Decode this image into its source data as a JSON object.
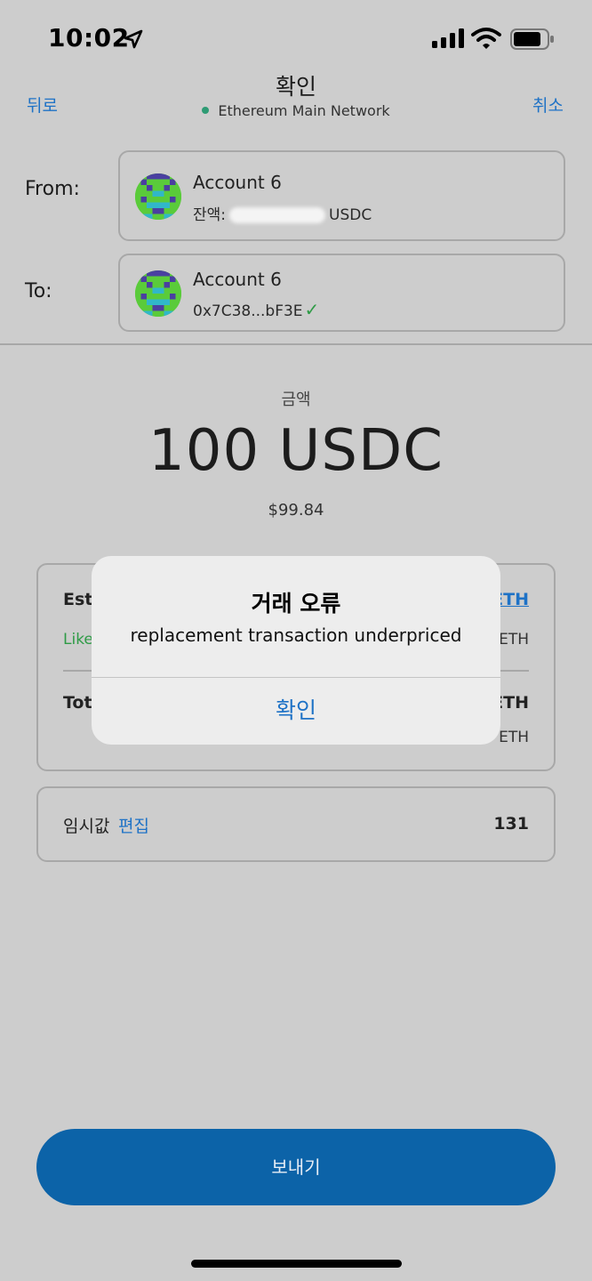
{
  "status_bar": {
    "time": "10:02",
    "icons": [
      "location-arrow-icon",
      "cellular-signal-icon",
      "wifi-icon",
      "battery-icon"
    ]
  },
  "nav": {
    "back_label": "뒤로",
    "title": "확인",
    "network": "Ethereum Main Network",
    "cancel_label": "취소"
  },
  "from": {
    "label": "From:",
    "account_name": "Account 6",
    "balance_prefix": "잔액:",
    "balance_suffix": "USDC"
  },
  "to": {
    "label": "To:",
    "account_name": "Account 6",
    "address": "0x7C38...bF3E"
  },
  "amount": {
    "label": "금액",
    "value": "100 USDC",
    "fiat": "$99.84"
  },
  "fee": {
    "estimated_label_partial": "Esti",
    "likely_partial": "Like",
    "eth_link_partial": "ETH",
    "eth_partial": "ETH",
    "total_label_partial": "Tot",
    "total_eth_partial": "ETH",
    "total_eth2_partial": "ETH"
  },
  "nonce": {
    "label": "임시값",
    "edit_label": "편집",
    "value": "131"
  },
  "send_button": "보내기",
  "alert": {
    "title": "거래 오류",
    "message": "replacement transaction underpriced",
    "ok_label": "확인"
  },
  "colors": {
    "link_blue": "#1e72c6",
    "primary_button": "#0c63a8",
    "network_dot": "#2e9b74",
    "success_green": "#2e9b46"
  }
}
